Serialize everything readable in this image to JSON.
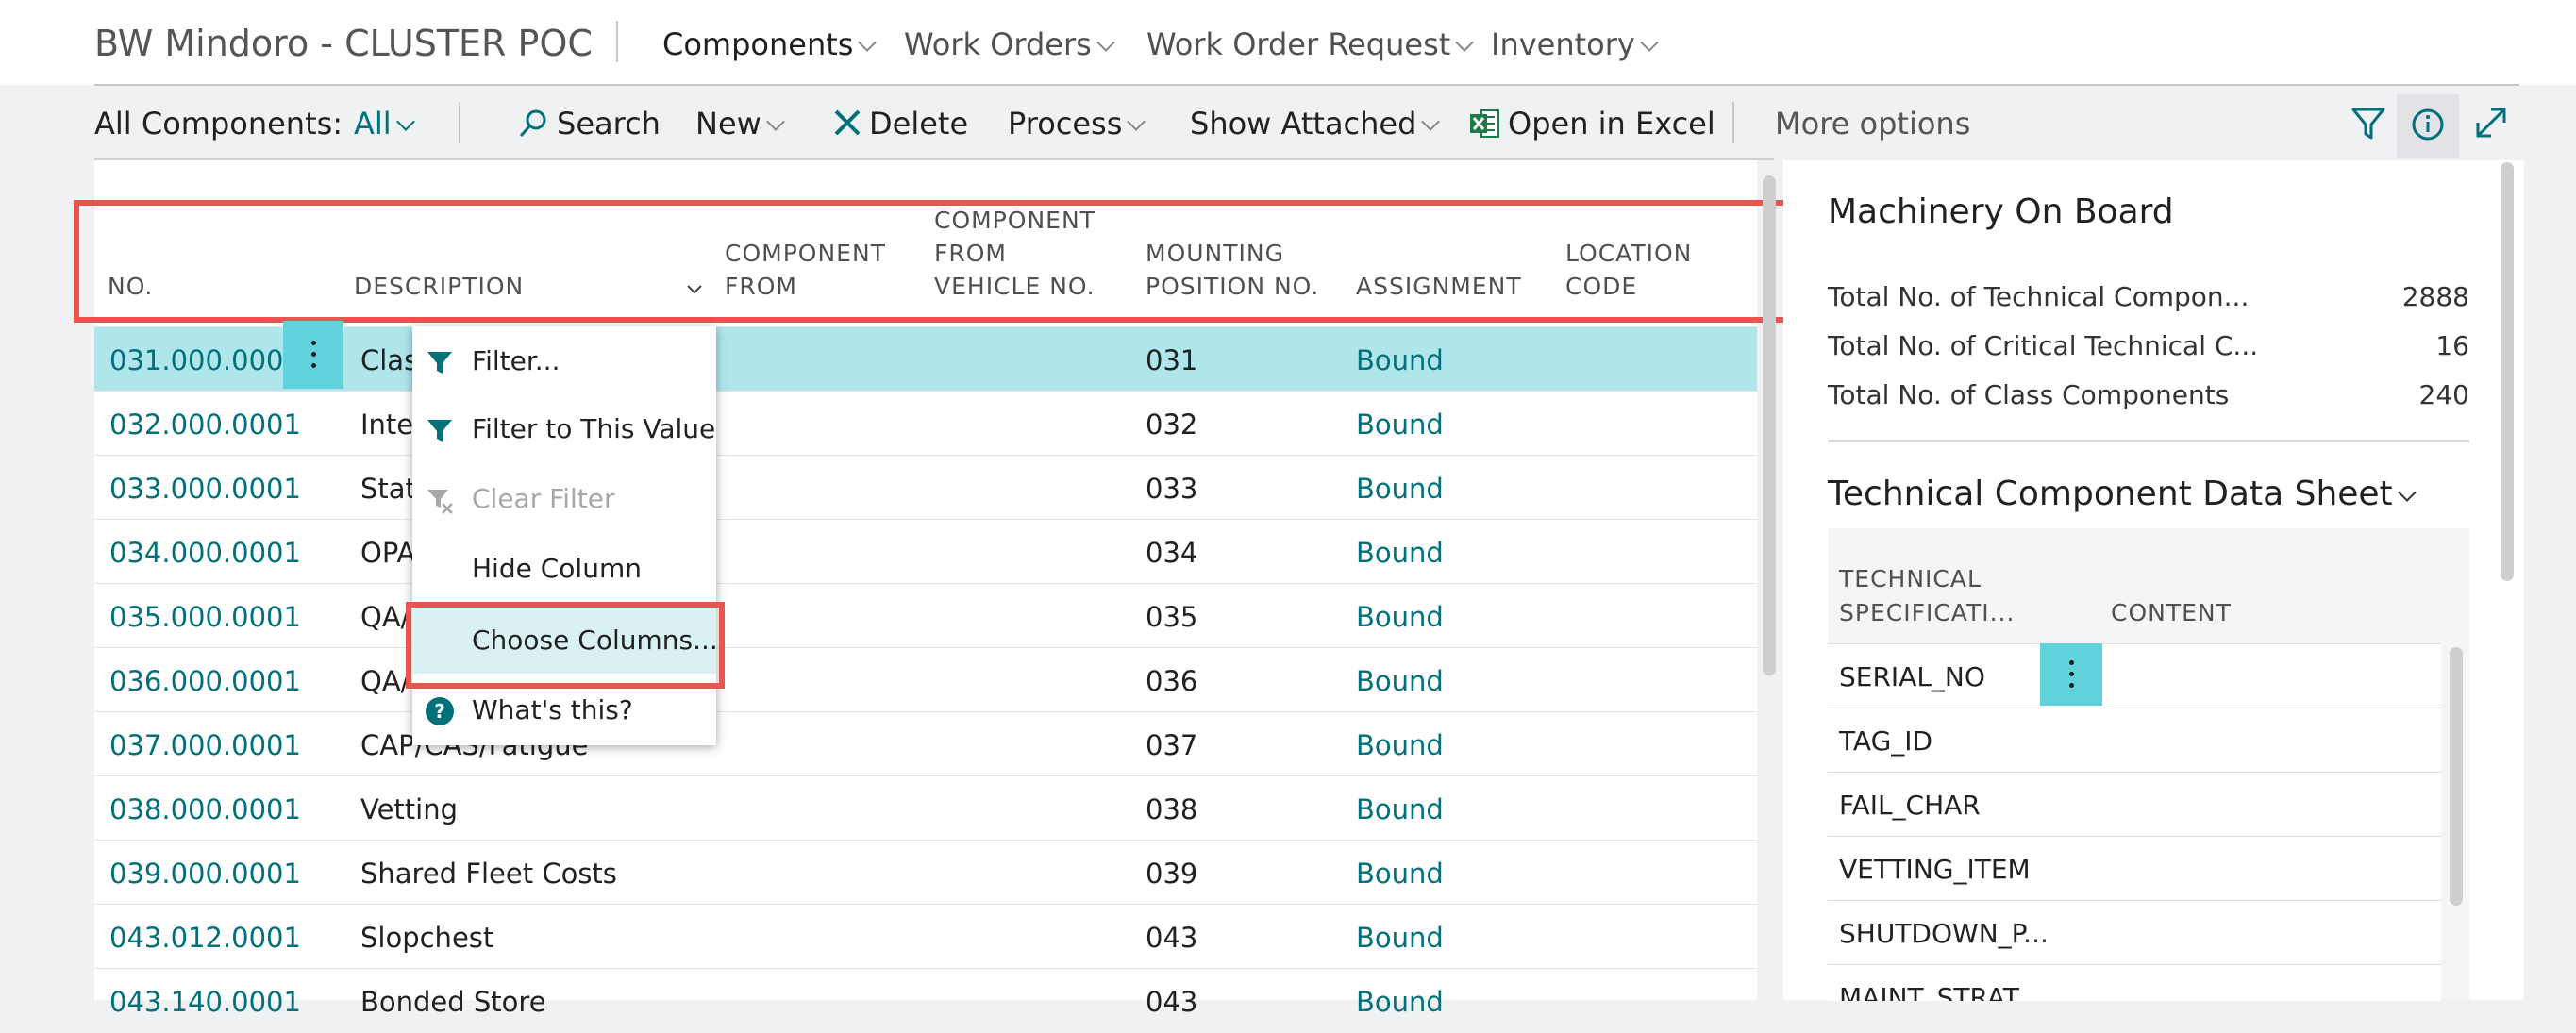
{
  "app": {
    "company": "BW Mindoro - CLUSTER POC",
    "nav": [
      "Components",
      "Work Orders",
      "Work Order Request",
      "Inventory"
    ]
  },
  "actionbar": {
    "view_label": "All Components:",
    "view_filter": "All",
    "search": "Search",
    "new": "New",
    "delete": "Delete",
    "process": "Process",
    "show_attached": "Show Attached",
    "open_excel": "Open in Excel",
    "more": "More options"
  },
  "list": {
    "columns": {
      "no": "NO.",
      "description": "DESCRIPTION",
      "component_from": [
        "COMPONENT",
        "FROM"
      ],
      "vehicle": [
        "COMPONENT",
        "FROM",
        "VEHICLE NO."
      ],
      "mounting": [
        "MOUNTING",
        "POSITION NO."
      ],
      "assignment": "ASSIGNMENT",
      "location": [
        "LOCATION",
        "CODE"
      ]
    },
    "rows": [
      {
        "no": "031.000.0001",
        "desc": "Class",
        "mount": "031",
        "assign": "Bound"
      },
      {
        "no": "032.000.0001",
        "desc": "Inter",
        "mount": "032",
        "assign": "Bound"
      },
      {
        "no": "033.000.0001",
        "desc": "Statu",
        "mount": "033",
        "assign": "Bound"
      },
      {
        "no": "034.000.0001",
        "desc": "OPAS",
        "mount": "034",
        "assign": "Bound"
      },
      {
        "no": "035.000.0001",
        "desc": "QA/",
        "mount": "035",
        "assign": "Bound"
      },
      {
        "no": "036.000.0001",
        "desc": "QA/",
        "mount": "036",
        "assign": "Bound"
      },
      {
        "no": "037.000.0001",
        "desc": "CAP/CAS/Fatigue",
        "mount": "037",
        "assign": "Bound"
      },
      {
        "no": "038.000.0001",
        "desc": "Vetting",
        "mount": "038",
        "assign": "Bound"
      },
      {
        "no": "039.000.0001",
        "desc": "Shared Fleet Costs",
        "mount": "039",
        "assign": "Bound"
      },
      {
        "no": "043.012.0001",
        "desc": "Slopchest",
        "mount": "043",
        "assign": "Bound"
      },
      {
        "no": "043.140.0001",
        "desc": "Bonded Store",
        "mount": "043",
        "assign": "Bound"
      }
    ]
  },
  "context_menu": {
    "filter": "Filter...",
    "filter_value": "Filter to This Value",
    "clear_filter": "Clear Filter",
    "hide_column": "Hide Column",
    "choose_columns": "Choose Columns...",
    "whats_this": "What's this?"
  },
  "factbox": {
    "title": "Machinery On Board",
    "stats": [
      {
        "label": "Total No. of Technical Compon...",
        "value": "2888"
      },
      {
        "label": "Total No. of Critical Technical C...",
        "value": "16"
      },
      {
        "label": "Total No. of Class Components",
        "value": "240"
      }
    ],
    "datasheet_title": "Technical Component Data Sheet",
    "datasheet_cols": {
      "spec": [
        "TECHNICAL",
        "SPECIFICATI..."
      ],
      "content": "CONTENT"
    },
    "datasheet_rows": [
      "SERIAL_NO",
      "TAG_ID",
      "FAIL_CHAR",
      "VETTING_ITEM",
      "SHUTDOWN_P...",
      "MAINT_STRAT..."
    ]
  },
  "colors": {
    "accent": "#00707a",
    "highlight": "#e8554e",
    "selected_row": "#aee6ec"
  }
}
